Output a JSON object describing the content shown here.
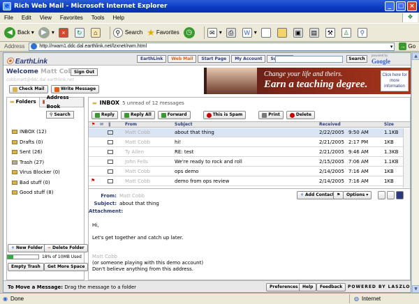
{
  "window": {
    "title": "Rich Web Mail - Microsoft Internet Explorer"
  },
  "menu": [
    "File",
    "Edit",
    "View",
    "Favorites",
    "Tools",
    "Help"
  ],
  "toolbar": {
    "back": "Back",
    "search": "Search",
    "favorites": "Favorites"
  },
  "address": {
    "label": "Address",
    "url": "http://rwam1.ddc.dal.earthlink.net/lzxnet/rwm.html",
    "go": "Go"
  },
  "header": {
    "logo": "EarthLink",
    "nav": [
      "EarthLink",
      "Web Mail",
      "Start Page",
      "My Account",
      "Support"
    ],
    "search_button": "Search",
    "powered": "powered by",
    "google": "Google"
  },
  "welcome": {
    "text": "Welcome",
    "user": "Matt Cobb!",
    "signout": "Sign Out",
    "email": "cobbmatt@ddc.dal.earthlink.net"
  },
  "actions": {
    "check_mail": "Check Mail",
    "write_message": "Write Message"
  },
  "ad": {
    "line1": "Change your life and theirs.",
    "line2": "Earn a teaching degree.",
    "click": "Click here for more information"
  },
  "left": {
    "tab_folders": "Folders",
    "tab_address": "Address Book",
    "search": "Search",
    "folders": [
      "INBOX (12)",
      "Drafts (0)",
      "Sent (26)",
      "Trash (27)",
      "Virus Blocker (0)",
      "Bad stuff (0)",
      "Good stuff (8)"
    ],
    "new_folder": "New Folder",
    "delete_folder": "Delete Folder",
    "quota_text": "18% of 10MB Used",
    "quota_pct": 0.18,
    "empty_trash": "Empty Trash",
    "get_more_space": "Get More Space"
  },
  "inbox": {
    "title": "INBOX",
    "count": "5 unread of 12 messages",
    "buttons": [
      "Reply",
      "Reply All",
      "Forward",
      "This is Spam",
      "Print",
      "Delete"
    ],
    "columns": {
      "from": "From",
      "subject": "Subject",
      "received": "Received",
      "size": "Size"
    },
    "rows": [
      {
        "from": "Matt Cobb",
        "subject": "about that thing",
        "date": "2/22/2005",
        "time": "9:50 AM",
        "size": "1.1KB"
      },
      {
        "from": "Matt Cobb",
        "subject": "hi!",
        "date": "2/21/2005",
        "time": "2:17 PM",
        "size": "1KB"
      },
      {
        "from": "Ty Allen",
        "subject": "RE: test",
        "date": "2/21/2005",
        "time": "9:46 AM",
        "size": "1.3KB"
      },
      {
        "from": "John Fells",
        "subject": "We're ready to rock and roll",
        "date": "2/15/2005",
        "time": "7:06 AM",
        "size": "1.1KB"
      },
      {
        "from": "Matt Cobb",
        "subject": "ops demo",
        "date": "2/14/2005",
        "time": "7:16 AM",
        "size": "1KB"
      },
      {
        "from": "Matt Cobb",
        "subject": "demo from ops review",
        "date": "2/14/2005",
        "time": "7:16 AM",
        "size": "1KB"
      }
    ]
  },
  "preview": {
    "from_label": "From:",
    "from": "Matt Cobb",
    "subject_label": "Subject:",
    "subject": "about that thing",
    "attachment_label": "Attachment:",
    "add_contact": "Add Contact",
    "options": "Options",
    "body": [
      "Hi,",
      "Let's get together and catch up later.",
      "Matt Cobb",
      "(or someone playing with this demo account)",
      "Don't believe anything from this address."
    ]
  },
  "footer": {
    "hint_bold": "To Move a Message:",
    "hint": "Drag the message to a folder",
    "preferences": "Preferences",
    "help": "Help",
    "feedback": "Feedback",
    "powered": "POWERED BY LASZLO"
  },
  "status": {
    "left": "Done",
    "zone": "Internet"
  }
}
